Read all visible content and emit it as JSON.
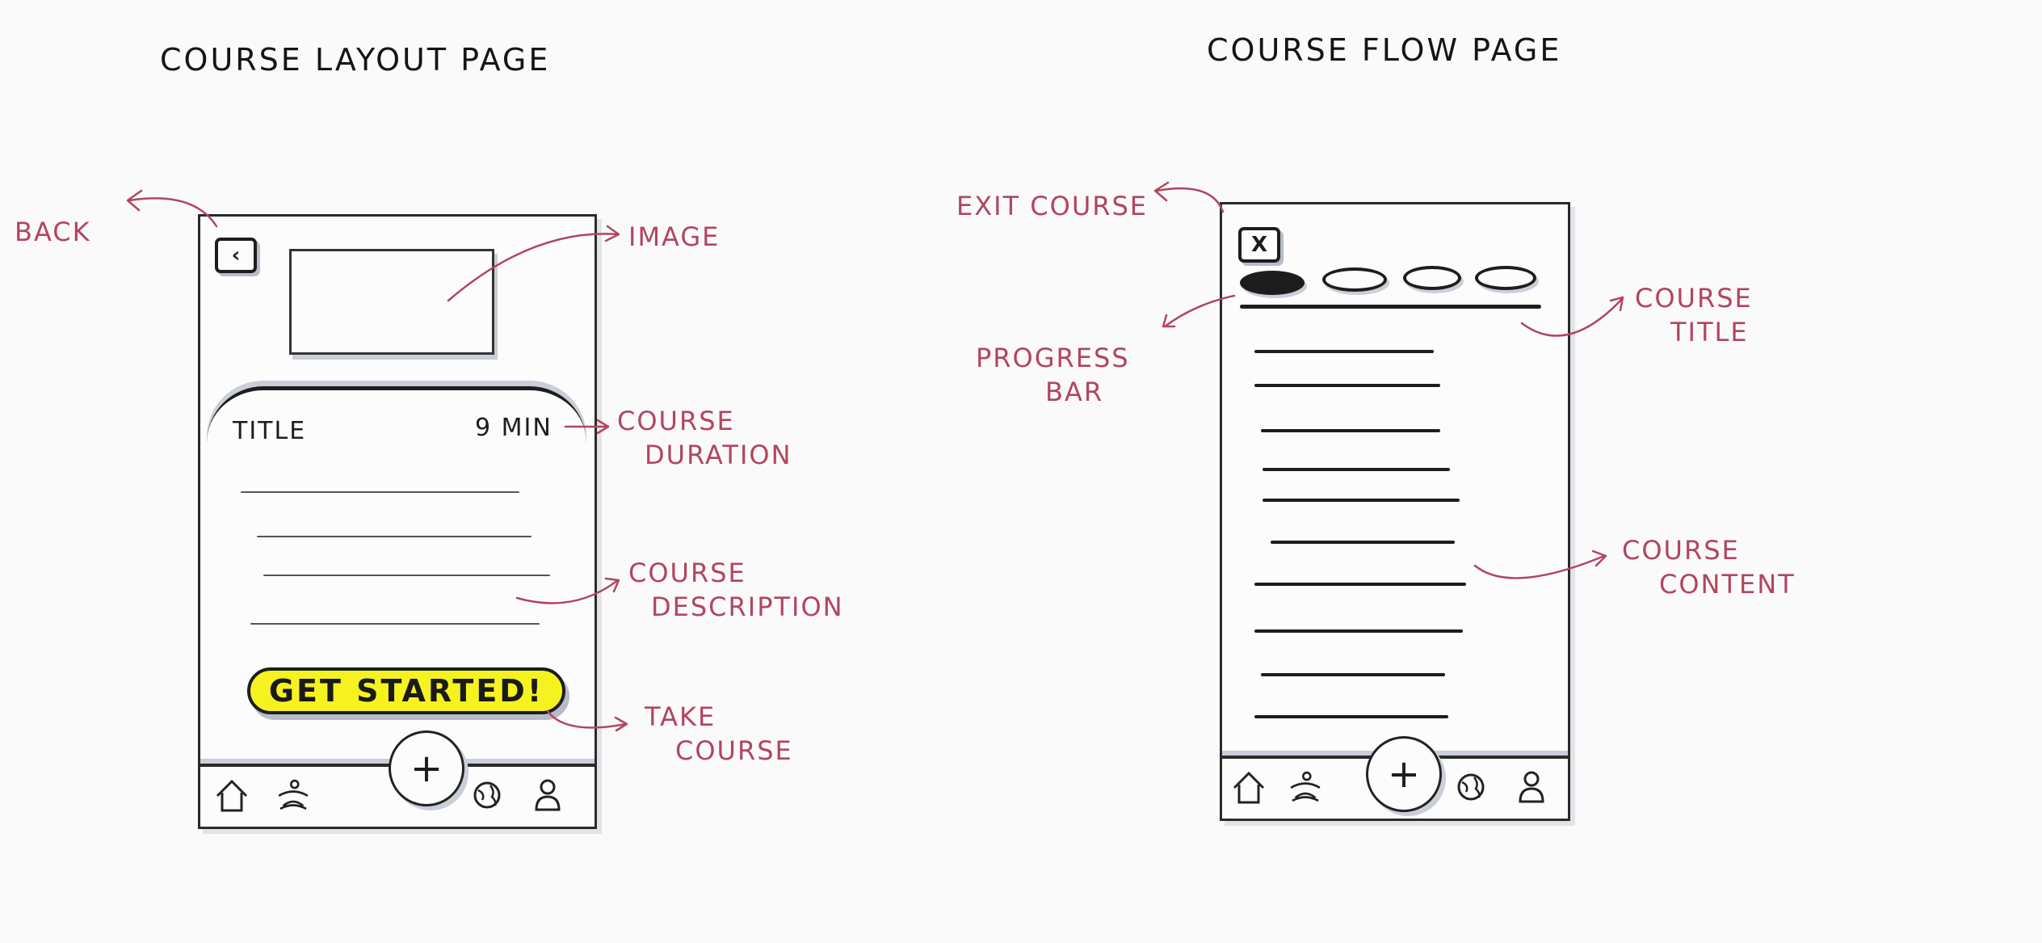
{
  "left_page": {
    "heading": "COURSE LAYOUT PAGE",
    "title": "TITLE",
    "duration": "9 MIN",
    "button_label": "GET STARTED!",
    "annotations": {
      "back": "BACK",
      "image": "IMAGE",
      "course_duration_1": "COURSE",
      "course_duration_2": "DURATION",
      "course_description_1": "COURSE",
      "course_description_2": "DESCRIPTION",
      "take_course_1": "TAKE",
      "take_course_2": "COURSE"
    }
  },
  "right_page": {
    "heading": "COURSE FLOW PAGE",
    "exit_label": "X",
    "progress_steps": 4,
    "progress_completed": 1,
    "annotations": {
      "exit_course": "EXIT COURSE",
      "progress_bar_1": "PROGRESS",
      "progress_bar_2": "BAR",
      "course_title_1": "COURSE",
      "course_title_2": "TITLE",
      "course_content_1": "COURSE",
      "course_content_2": "CONTENT"
    }
  },
  "fab_symbol": "+",
  "colors": {
    "annotation": "#b2455f",
    "cta_fill": "#f6f21f",
    "ink": "#1d1d1d",
    "shadow": "#c9ced8"
  },
  "nav_icons": [
    "home-icon",
    "meditation-icon",
    "globe-icon",
    "profile-icon"
  ]
}
